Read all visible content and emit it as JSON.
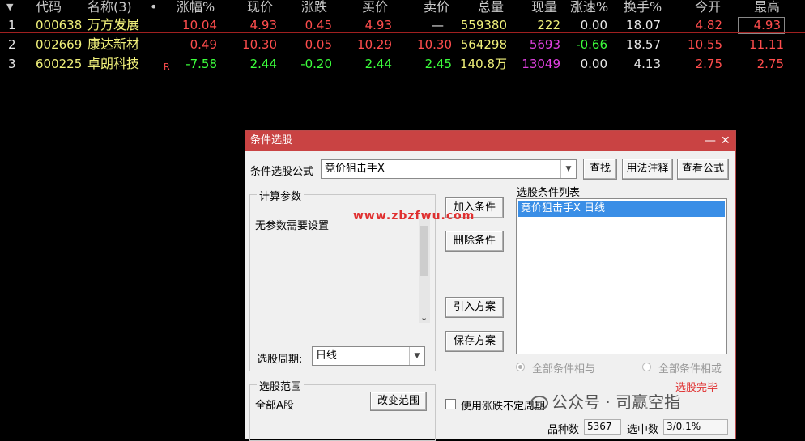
{
  "quote_table": {
    "sort_arrow": "▼",
    "dot": "•",
    "headers": [
      "代码",
      "名称(3)",
      "涨幅%",
      "现价",
      "涨跌",
      "买价",
      "卖价",
      "总量",
      "现量",
      "涨速%",
      "换手%",
      "今开",
      "最高"
    ],
    "rows": [
      {
        "idx": "1",
        "code": "000638",
        "name": "万方发展",
        "flag": "",
        "chg_pct": "10.04",
        "price": "4.93",
        "chg": "0.45",
        "bid": "4.93",
        "ask": "—",
        "vol": "559380",
        "cur_vol": "222",
        "speed": "0.00",
        "turnover": "18.07",
        "open": "4.82",
        "high": "4.93"
      },
      {
        "idx": "2",
        "code": "002669",
        "name": "康达新材",
        "flag": "",
        "chg_pct": "0.49",
        "price": "10.30",
        "chg": "0.05",
        "bid": "10.29",
        "ask": "10.30",
        "vol": "564298",
        "cur_vol": "5693",
        "speed": "-0.66",
        "turnover": "18.57",
        "open": "10.55",
        "high": "11.11"
      },
      {
        "idx": "3",
        "code": "600225",
        "name": "卓朗科技",
        "flag": "R",
        "chg_pct": "-7.58",
        "price": "2.44",
        "chg": "-0.20",
        "bid": "2.44",
        "ask": "2.45",
        "vol": "140.8万",
        "cur_vol": "13049",
        "speed": "0.00",
        "turnover": "4.13",
        "open": "2.75",
        "high": "2.75"
      }
    ]
  },
  "dialog": {
    "title": "条件选股",
    "minimize": "—",
    "close": "✕",
    "formula_label": "条件选股公式",
    "formula_value": "竞价狙击手X",
    "btn_find": "查找",
    "btn_usage": "用法注释",
    "btn_view": "查看公式",
    "params_group": "计算参数",
    "params_text": "无参数需要设置",
    "period_label": "选股周期:",
    "period_value": "日线",
    "btn_add": "加入条件",
    "btn_delete": "删除条件",
    "btn_import": "引入方案",
    "btn_save": "保存方案",
    "cond_list_label": "选股条件列表",
    "cond_items": [
      "竞价狙击手X  日线"
    ],
    "radio_and": "全部条件相与",
    "radio_or": "全部条件相或",
    "scope_group": "选股范围",
    "scope_value": "全部A股",
    "btn_change_scope": "改变范围",
    "checkbox_label": "使用涨跌不定周期",
    "status": "选股完毕",
    "count_label": "品种数",
    "count_value": "5367",
    "selected_label": "选中数",
    "selected_value": "3/0.1%"
  },
  "watermark": "www.zbzfwu.com",
  "wechat_watermark": "公众号 · 司赢空指",
  "colors": {
    "up": "#ff4d4d",
    "down": "#3cff3c",
    "title_bar": "#c94343",
    "selection": "#3a8ee6"
  }
}
